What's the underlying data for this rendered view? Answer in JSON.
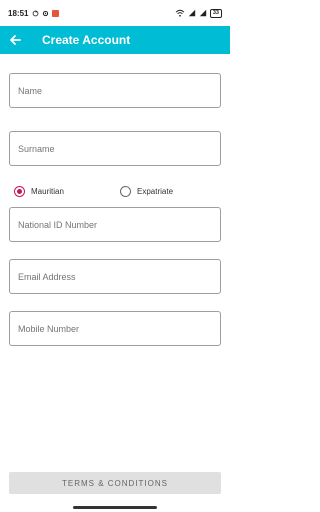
{
  "status_bar": {
    "time": "18:51",
    "battery": "33"
  },
  "app_bar": {
    "title": "Create Account",
    "background": "#00bcd4"
  },
  "form": {
    "name_placeholder": "Name",
    "surname_placeholder": "Surname",
    "residency": {
      "options": [
        "Mauritian",
        "Expatriate"
      ],
      "selected": "Mauritian",
      "accent": "#c2185b"
    },
    "national_id_placeholder": "National ID Number",
    "email_placeholder": "Email Address",
    "mobile_placeholder": "Mobile Number"
  },
  "footer": {
    "terms_label": "TERMS & CONDITIONS"
  },
  "icons": {
    "back": "arrow-left-icon"
  }
}
